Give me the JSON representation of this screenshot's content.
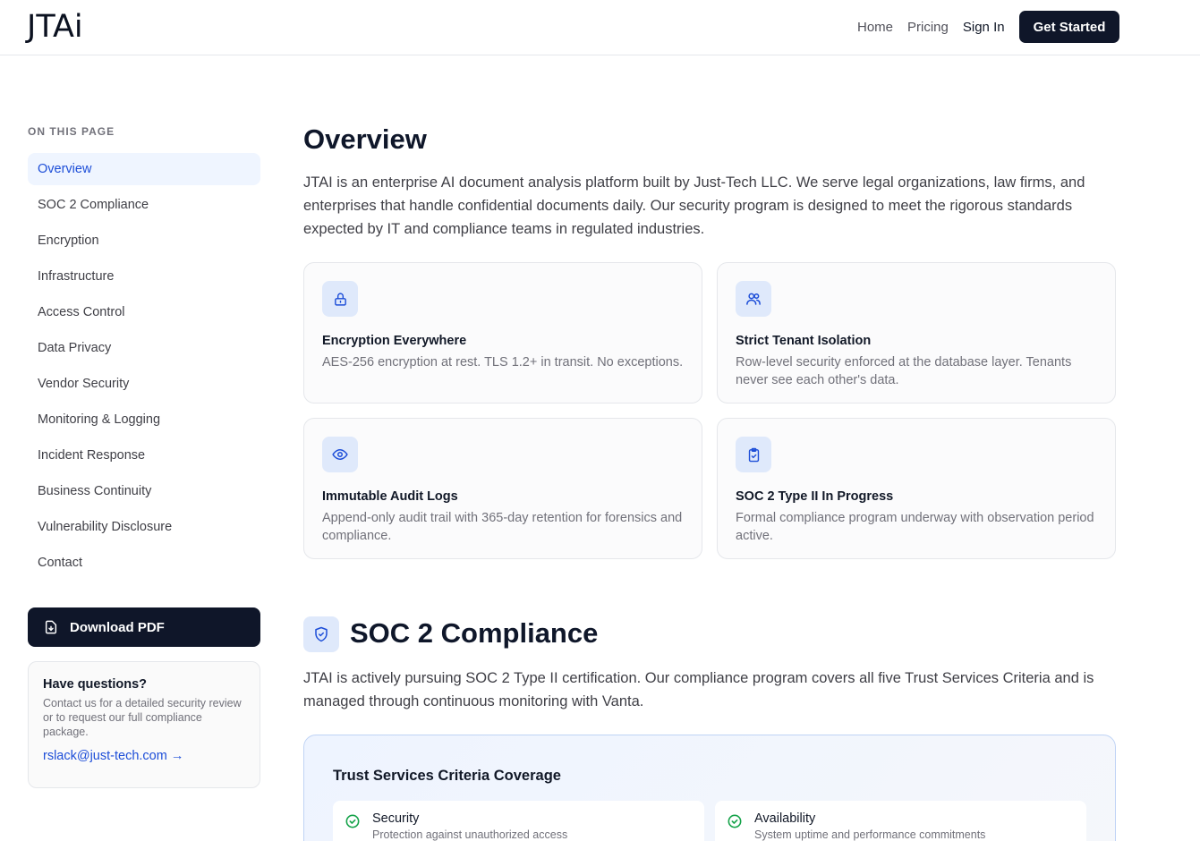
{
  "header": {
    "logo": "JTAi",
    "nav": [
      "Home",
      "Pricing",
      "Sign In"
    ],
    "cta": "Get Started"
  },
  "sidebar": {
    "title": "ON THIS PAGE",
    "items": [
      {
        "label": "Overview",
        "active": true
      },
      {
        "label": "SOC 2 Compliance"
      },
      {
        "label": "Encryption"
      },
      {
        "label": "Infrastructure"
      },
      {
        "label": "Access Control"
      },
      {
        "label": "Data Privacy"
      },
      {
        "label": "Vendor Security"
      },
      {
        "label": "Monitoring & Logging"
      },
      {
        "label": "Incident Response"
      },
      {
        "label": "Business Continuity"
      },
      {
        "label": "Vulnerability Disclosure"
      },
      {
        "label": "Contact"
      }
    ],
    "download_label": "Download PDF",
    "questions": {
      "title": "Have questions?",
      "text": "Contact us for a detailed security review or to request our full compliance package.",
      "email": "rslack@just-tech.com →"
    }
  },
  "overview": {
    "title": "Overview",
    "lead": "JTAI is an enterprise AI document analysis platform built by Just-Tech LLC. We serve legal organizations, law firms, and enterprises that handle confidential documents daily. Our security program is designed to meet the rigorous standards expected by IT and compliance teams in regulated industries.",
    "cards": [
      {
        "icon": "lock-icon",
        "title": "Encryption Everywhere",
        "text": "AES-256 encryption at rest. TLS 1.2+ in transit. No exceptions."
      },
      {
        "icon": "users-icon",
        "title": "Strict Tenant Isolation",
        "text": "Row-level security enforced at the database layer. Tenants never see each other's data."
      },
      {
        "icon": "eye-icon",
        "title": "Immutable Audit Logs",
        "text": "Append-only audit trail with 365-day retention for forensics and compliance."
      },
      {
        "icon": "clipboard-check-icon",
        "title": "SOC 2 Type II In Progress",
        "text": "Formal compliance program underway with observation period active."
      }
    ]
  },
  "soc2": {
    "title": "SOC 2 Compliance",
    "lead": "JTAI is actively pursuing SOC 2 Type II certification. Our compliance program covers all five Trust Services Criteria and is managed through continuous monitoring with Vanta.",
    "criteria_title": "Trust Services Criteria Coverage",
    "criteria": [
      {
        "name": "Security",
        "desc": "Protection against unauthorized access"
      },
      {
        "name": "Availability",
        "desc": "System uptime and performance commitments"
      }
    ]
  },
  "colors": {
    "accent": "#1d4ed8",
    "dark": "#0f1629",
    "icon_bg": "#dfe9fb",
    "success": "#16a34a"
  }
}
